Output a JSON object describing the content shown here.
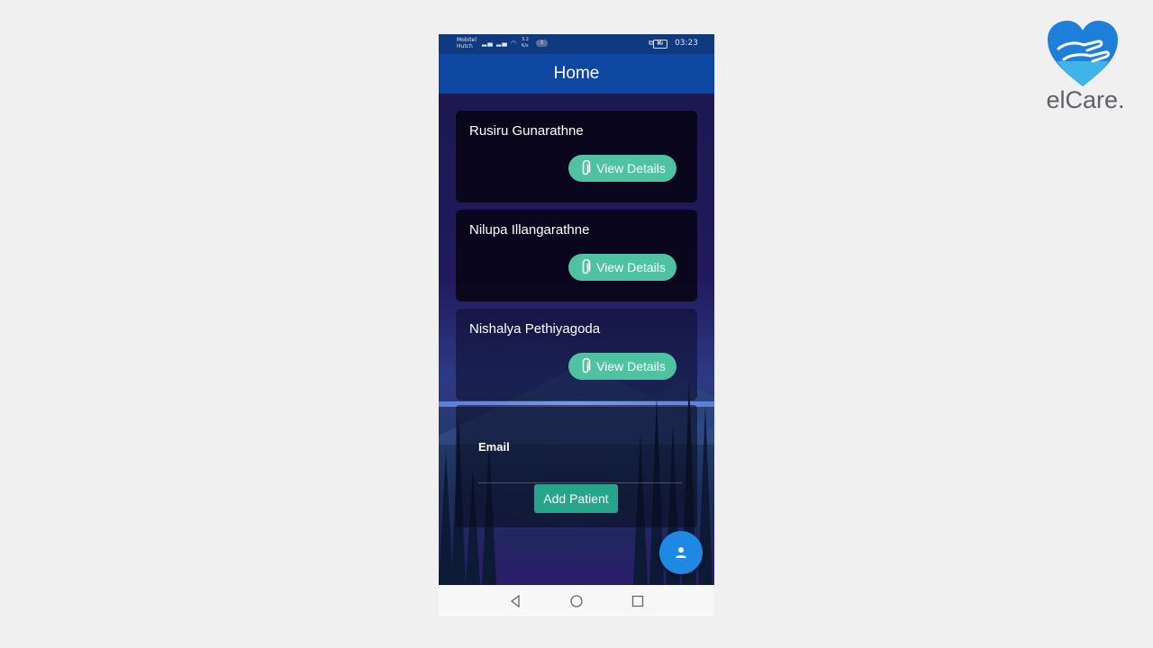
{
  "status_bar": {
    "carrier_1": "Mobitel",
    "carrier_2": "Hutch",
    "speed_value": "3.2",
    "speed_unit": "K/s",
    "notification_count": "3",
    "battery": "99",
    "time": "03:23"
  },
  "app_bar": {
    "title": "Home"
  },
  "patients": [
    {
      "name": "Rusiru Gunarathne",
      "button_label": "View Details"
    },
    {
      "name": "Nilupa Illangarathne",
      "button_label": "View Details"
    },
    {
      "name": "Nishalya Pethiyagoda",
      "button_label": "View Details"
    }
  ],
  "add_patient": {
    "email_label": "Email",
    "email_value": "",
    "button_label": "Add Patient"
  },
  "fab": {
    "icon": "person-icon"
  },
  "nav_bar": {
    "icons": [
      "back-icon",
      "home-icon",
      "recents-icon"
    ]
  },
  "logo": {
    "text": "elCare."
  },
  "colors": {
    "app_bar": "#0d47a1",
    "view_button": "#4fc2a2",
    "add_button": "#26a58a",
    "fab": "#1e88e5",
    "logo_blue": "#1e7fd8"
  }
}
